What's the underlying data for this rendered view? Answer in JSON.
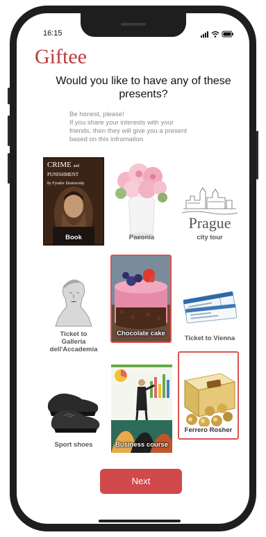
{
  "status": {
    "time": "16:15"
  },
  "app": {
    "brand": "Giftee"
  },
  "question": "Would you like to have any of these presents?",
  "hint": {
    "lines": [
      "Be honest, please!",
      "If you share your interests with your",
      "friends, then they will give you a present",
      "based on this infromation"
    ]
  },
  "book_cover": {
    "title_line1": "CRIME",
    "title_and": "and",
    "title_line2": "PUNISHMENT",
    "author": "by Fyodor Dostoevsky"
  },
  "prague_word": "Prague",
  "gifts": [
    {
      "label": "Book",
      "selected": true
    },
    {
      "label": "Paeonia",
      "selected": false
    },
    {
      "label": "city tour",
      "selected": false
    },
    {
      "label_lines": [
        "Ticket to",
        "Galleria",
        "dell'Accademia"
      ],
      "selected": false
    },
    {
      "label": "Chocolate cake",
      "selected": true
    },
    {
      "label": "Ticket to Vienna",
      "selected": false
    },
    {
      "label": "Sport shoes",
      "selected": false
    },
    {
      "label": "Business course",
      "selected": false
    },
    {
      "label": "Ferrero Rosher",
      "selected": true
    }
  ],
  "next_button": {
    "label": "Next"
  },
  "colors": {
    "accent": "#d0494b",
    "brand": "#c0393b",
    "frame": "#1e1e1e"
  }
}
